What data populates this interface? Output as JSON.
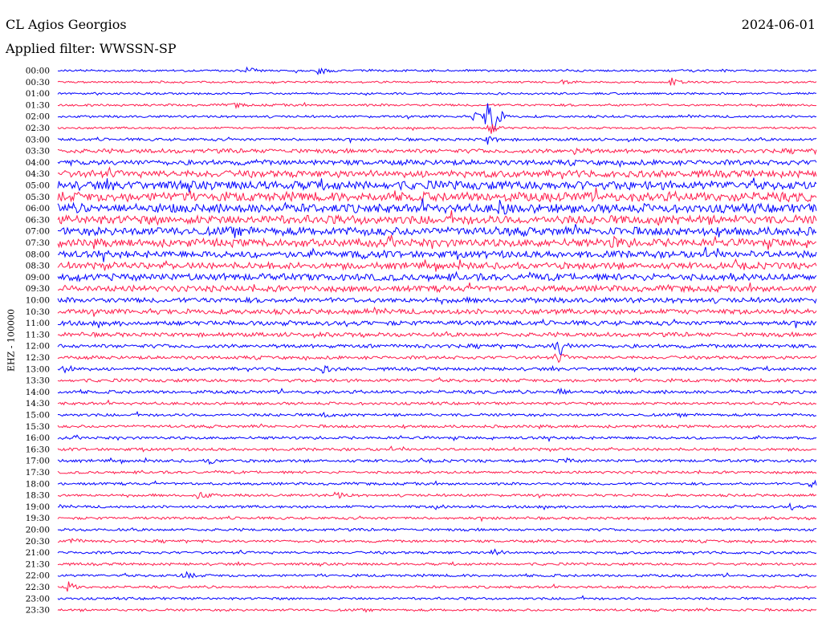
{
  "header": {
    "station": "CL Agios Georgios",
    "date": "2024-06-01",
    "filter": "Applied filter: WWSSN-SP"
  },
  "colors": {
    "trace_a": "#0000ff",
    "trace_b": "#ff1a4b",
    "text": "#000000",
    "background": "#ffffff"
  },
  "chart_data": {
    "type": "line",
    "subtype": "helicorder",
    "ylabel": "EHZ - 100000",
    "x_unit": "minutes within each 30-minute row",
    "xlim": [
      0,
      30
    ],
    "row_labels": [
      "00:00",
      "00:30",
      "01:00",
      "01:30",
      "02:00",
      "02:30",
      "03:00",
      "03:30",
      "04:00",
      "04:30",
      "05:00",
      "05:30",
      "06:00",
      "06:30",
      "07:00",
      "07:30",
      "08:00",
      "08:30",
      "09:00",
      "09:30",
      "10:00",
      "10:30",
      "11:00",
      "11:30",
      "12:00",
      "12:30",
      "13:00",
      "13:30",
      "14:00",
      "14:30",
      "15:00",
      "15:30",
      "16:00",
      "16:30",
      "17:00",
      "17:30",
      "18:00",
      "18:30",
      "19:00",
      "19:30",
      "20:00",
      "20:30",
      "21:00",
      "21:30",
      "22:00",
      "22:30",
      "23:00",
      "23:30"
    ],
    "series_colors": [
      "#0000ff",
      "#ff1a4b"
    ],
    "noise_amplitude": [
      0.22,
      0.2,
      0.22,
      0.25,
      0.25,
      0.22,
      0.3,
      0.45,
      0.55,
      0.75,
      0.95,
      1.0,
      0.95,
      0.95,
      0.9,
      0.85,
      0.75,
      0.7,
      0.75,
      0.65,
      0.55,
      0.55,
      0.5,
      0.45,
      0.4,
      0.35,
      0.35,
      0.35,
      0.35,
      0.3,
      0.3,
      0.3,
      0.3,
      0.3,
      0.3,
      0.28,
      0.28,
      0.28,
      0.28,
      0.28,
      0.28,
      0.28,
      0.28,
      0.28,
      0.28,
      0.26,
      0.26,
      0.26
    ],
    "events": [
      {
        "row": 0,
        "minute": 7.5,
        "amplitude": 0.8
      },
      {
        "row": 0,
        "minute": 10.3,
        "amplitude": 1.3
      },
      {
        "row": 1,
        "minute": 24.3,
        "amplitude": 1.0
      },
      {
        "row": 1,
        "minute": 20.0,
        "amplitude": 0.5
      },
      {
        "row": 3,
        "minute": 7.0,
        "amplitude": 0.6
      },
      {
        "row": 4,
        "minute": 17.0,
        "amplitude": 4.5
      },
      {
        "row": 4,
        "minute": 17.2,
        "amplitude": 2.8
      },
      {
        "row": 4,
        "minute": 16.5,
        "amplitude": 1.4
      },
      {
        "row": 5,
        "minute": 17.1,
        "amplitude": 1.6
      },
      {
        "row": 6,
        "minute": 17.0,
        "amplitude": 1.0
      },
      {
        "row": 7,
        "minute": 20.5,
        "amplitude": 1.0
      },
      {
        "row": 12,
        "minute": 17.5,
        "amplitude": 1.4
      },
      {
        "row": 15,
        "minute": 22.0,
        "amplitude": 1.2
      },
      {
        "row": 16,
        "minute": 11.8,
        "amplitude": 1.2
      },
      {
        "row": 24,
        "minute": 19.7,
        "amplitude": 1.8
      },
      {
        "row": 24,
        "minute": 19.9,
        "amplitude": 1.2
      },
      {
        "row": 25,
        "minute": 19.8,
        "amplitude": 1.0
      },
      {
        "row": 26,
        "minute": 0.3,
        "amplitude": 1.6
      },
      {
        "row": 26,
        "minute": 10.5,
        "amplitude": 0.8
      },
      {
        "row": 28,
        "minute": 19.8,
        "amplitude": 0.9
      },
      {
        "row": 30,
        "minute": 10.5,
        "amplitude": 0.6
      },
      {
        "row": 34,
        "minute": 20.0,
        "amplitude": 0.8
      },
      {
        "row": 34,
        "minute": 6.0,
        "amplitude": 0.6
      },
      {
        "row": 36,
        "minute": 29.8,
        "amplitude": 1.2
      },
      {
        "row": 37,
        "minute": 5.6,
        "amplitude": 1.3
      },
      {
        "row": 37,
        "minute": 11.0,
        "amplitude": 1.0
      },
      {
        "row": 38,
        "minute": 29.0,
        "amplitude": 0.7
      },
      {
        "row": 38,
        "minute": 15.0,
        "amplitude": 0.6
      },
      {
        "row": 41,
        "minute": 0.5,
        "amplitude": 0.9
      },
      {
        "row": 42,
        "minute": 17.2,
        "amplitude": 1.0
      },
      {
        "row": 44,
        "minute": 5.0,
        "amplitude": 1.0
      },
      {
        "row": 45,
        "minute": 0.4,
        "amplitude": 1.3
      }
    ]
  }
}
